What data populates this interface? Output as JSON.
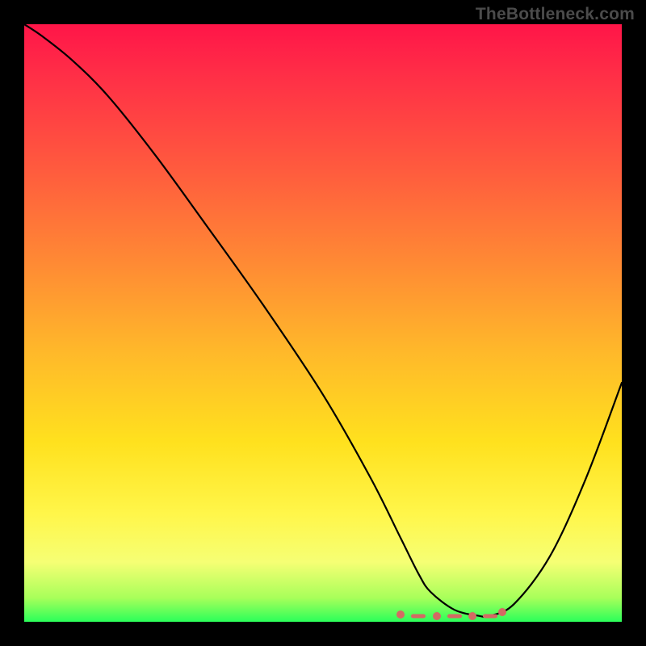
{
  "watermark": "TheBottleneck.com",
  "colors": {
    "frame_background": "#000000",
    "watermark_text": "#4b4b4b",
    "curve_stroke": "#000000",
    "marker": "#d46a63"
  },
  "chart_data": {
    "type": "line",
    "title": "",
    "xlabel": "",
    "ylabel": "",
    "xlim": [
      0,
      100
    ],
    "ylim": [
      0,
      100
    ],
    "grid": false,
    "legend": false,
    "series": [
      {
        "name": "bottleneck-curve",
        "x": [
          0,
          3,
          8,
          14,
          22,
          30,
          40,
          50,
          58,
          63,
          66,
          68,
          72,
          76,
          78,
          82,
          88,
          94,
          100
        ],
        "y": [
          100,
          98,
          94,
          88,
          78,
          67,
          53,
          38,
          24,
          14,
          8,
          5,
          2,
          1,
          1,
          3,
          11,
          24,
          40
        ]
      }
    ],
    "markers": {
      "name": "optimal-region",
      "style": "dot-dash",
      "x": [
        63,
        66,
        69,
        72,
        75,
        78,
        80
      ],
      "y": [
        1.2,
        1.0,
        0.9,
        0.9,
        0.9,
        1.0,
        1.6
      ]
    }
  }
}
